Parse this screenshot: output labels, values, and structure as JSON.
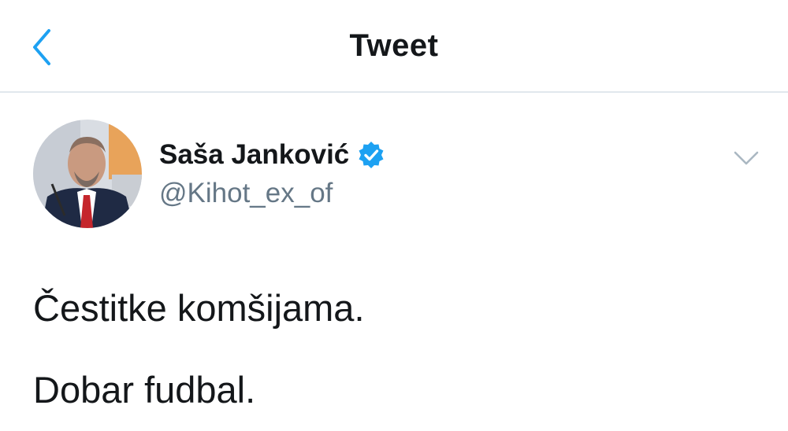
{
  "header": {
    "title": "Tweet",
    "back_icon": "chevron-left-icon",
    "accent_color": "#1da1f2"
  },
  "tweet": {
    "author": {
      "name": "Saša Janković",
      "handle": "@Kihot_ex_of",
      "verified": true,
      "verified_icon": "verified-badge-icon"
    },
    "menu_icon": "chevron-down-icon",
    "text_lines": [
      "Čestitke komšijama.",
      "Dobar fudbal."
    ]
  }
}
